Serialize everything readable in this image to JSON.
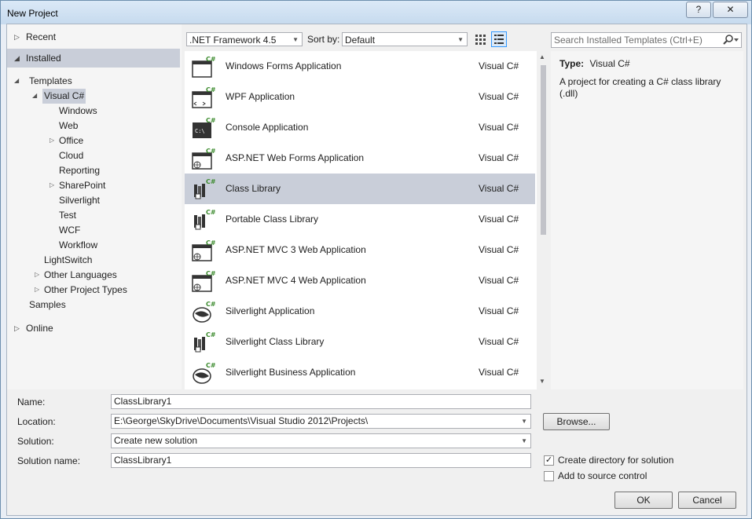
{
  "window": {
    "title": "New Project",
    "help_label": "?",
    "close_label": "✕"
  },
  "nav": {
    "recent": "Recent",
    "installed": "Installed",
    "online": "Online",
    "tree": {
      "templates": "Templates",
      "visual_csharp": "Visual C#",
      "children": [
        "Windows",
        "Web",
        "Office",
        "Cloud",
        "Reporting",
        "SharePoint",
        "Silverlight",
        "Test",
        "WCF",
        "Workflow"
      ],
      "lightswitch": "LightSwitch",
      "other_languages": "Other Languages",
      "other_project_types": "Other Project Types",
      "samples": "Samples"
    }
  },
  "toolbar": {
    "framework": ".NET Framework 4.5",
    "sort_label": "Sort by:",
    "sort_value": "Default",
    "search_placeholder": "Search Installed Templates (Ctrl+E)"
  },
  "templates": [
    {
      "name": "Windows Forms Application",
      "lang": "Visual C#",
      "icon": "windows-forms-icon"
    },
    {
      "name": "WPF Application",
      "lang": "Visual C#",
      "icon": "wpf-icon"
    },
    {
      "name": "Console Application",
      "lang": "Visual C#",
      "icon": "console-icon"
    },
    {
      "name": "ASP.NET Web Forms Application",
      "lang": "Visual C#",
      "icon": "web-forms-icon"
    },
    {
      "name": "Class Library",
      "lang": "Visual C#",
      "icon": "class-library-icon",
      "selected": true
    },
    {
      "name": "Portable Class Library",
      "lang": "Visual C#",
      "icon": "portable-library-icon"
    },
    {
      "name": "ASP.NET MVC 3 Web Application",
      "lang": "Visual C#",
      "icon": "mvc-icon"
    },
    {
      "name": "ASP.NET MVC 4 Web Application",
      "lang": "Visual C#",
      "icon": "mvc-icon"
    },
    {
      "name": "Silverlight Application",
      "lang": "Visual C#",
      "icon": "silverlight-icon"
    },
    {
      "name": "Silverlight Class Library",
      "lang": "Visual C#",
      "icon": "silverlight-library-icon"
    },
    {
      "name": "Silverlight Business Application",
      "lang": "Visual C#",
      "icon": "silverlight-icon"
    }
  ],
  "info": {
    "type_label": "Type:",
    "type_value": "Visual C#",
    "description": "A project for creating a C# class library (.dll)"
  },
  "form": {
    "name_label": "Name:",
    "name_value": "ClassLibrary1",
    "location_label": "Location:",
    "location_value": "E:\\George\\SkyDrive\\Documents\\Visual Studio 2012\\Projects\\",
    "solution_label": "Solution:",
    "solution_value": "Create new solution",
    "solution_name_label": "Solution name:",
    "solution_name_value": "ClassLibrary1",
    "browse_label": "Browse...",
    "create_dir_label": "Create directory for solution",
    "create_dir_checked": true,
    "source_control_label": "Add to source control",
    "source_control_checked": false,
    "ok_label": "OK",
    "cancel_label": "Cancel"
  },
  "colors": {
    "selection": "#c9ced9",
    "accent_green": "#3c8b2e"
  }
}
